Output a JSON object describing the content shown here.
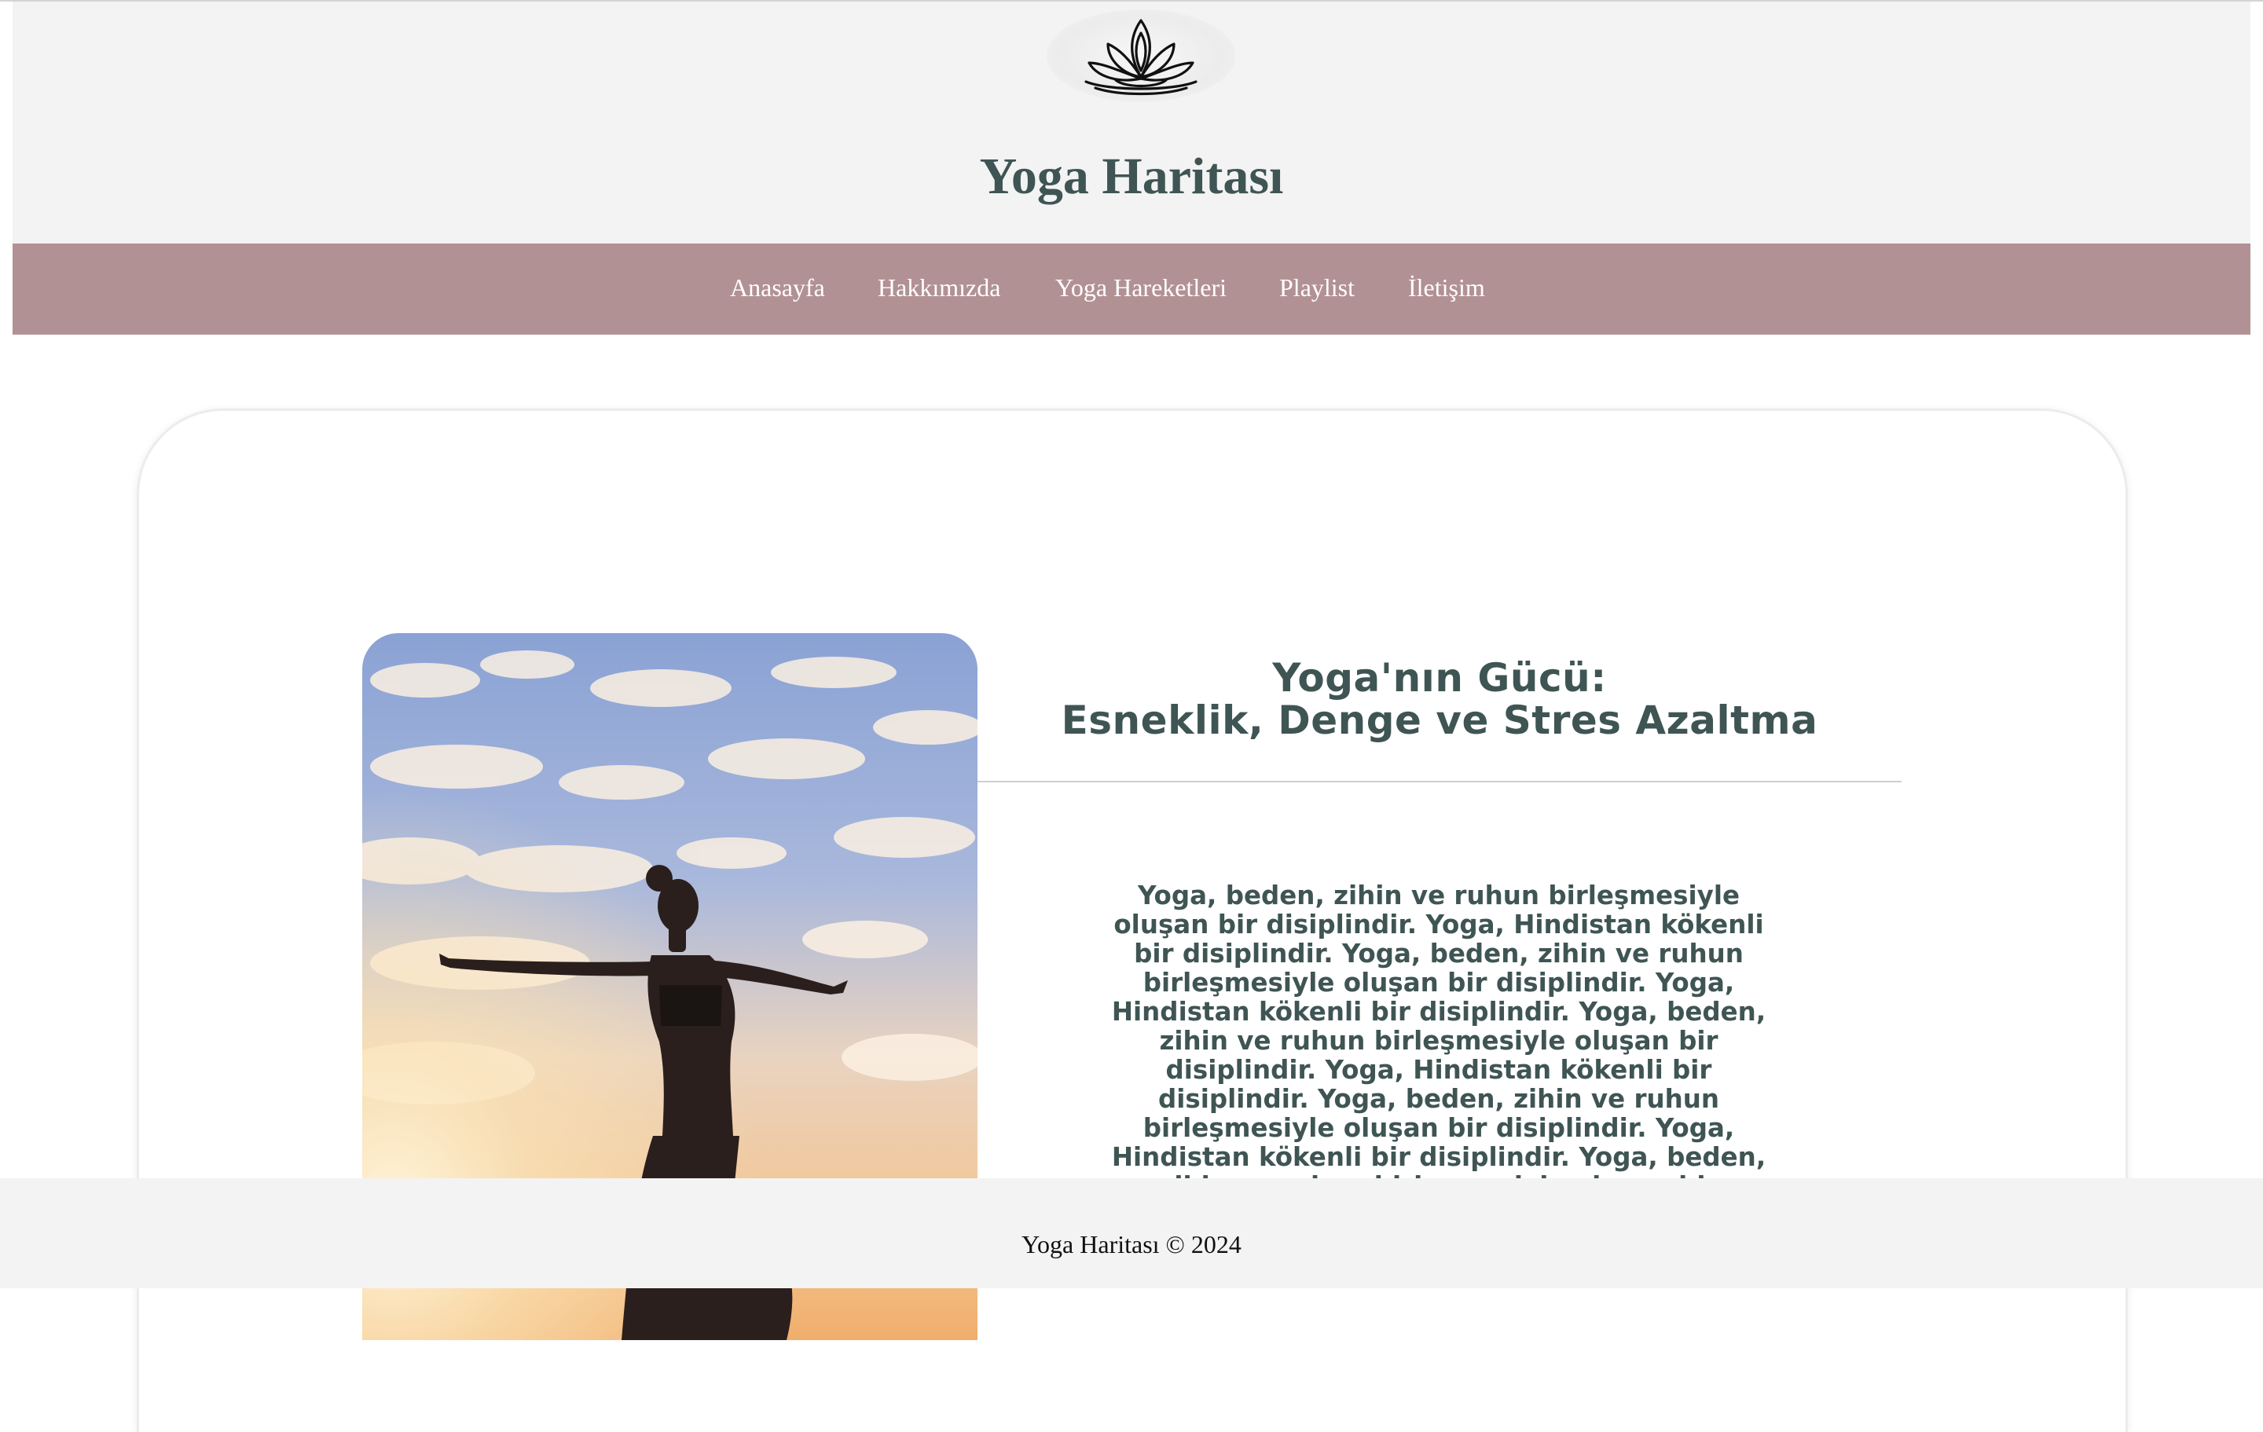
{
  "header": {
    "logo_icon": "lotus-icon",
    "title": "Yoga Haritası"
  },
  "nav": {
    "items": [
      {
        "label": "Anasayfa"
      },
      {
        "label": "Hakkımızda"
      },
      {
        "label": "Yoga Hareketleri"
      },
      {
        "label": "Playlist"
      },
      {
        "label": "İletişim"
      }
    ]
  },
  "main": {
    "image_alt_icon": "yoga-pose-photo",
    "title_line1": "Yoga'nın Gücü:",
    "title_line2": "Esneklik, Denge ve Stres Azaltma",
    "paragraph": "Yoga, beden, zihin ve ruhun birleşmesiyle oluşan bir disiplindir. Yoga, Hindistan kökenli bir disiplindir. Yoga, beden, zihin ve ruhun birleşmesiyle oluşan bir disiplindir. Yoga, Hindistan kökenli bir disiplindir. Yoga, beden, zihin ve ruhun birleşmesiyle oluşan bir disiplindir. Yoga, Hindistan kökenli bir disiplindir. Yoga, beden, zihin ve ruhun birleşmesiyle oluşan bir disiplindir. Yoga, Hindistan kökenli bir disiplindir. Yoga, beden, zihin ve ruhun birleşmesiyle oluşan bir disiplindir. Yoga, Hindistan kökenli bir disiplindir."
  },
  "footer": {
    "text": "Yoga Haritası © 2024"
  },
  "colors": {
    "title": "#3f5554",
    "nav_background": "#b29194",
    "header_background": "#f3f3f3"
  }
}
